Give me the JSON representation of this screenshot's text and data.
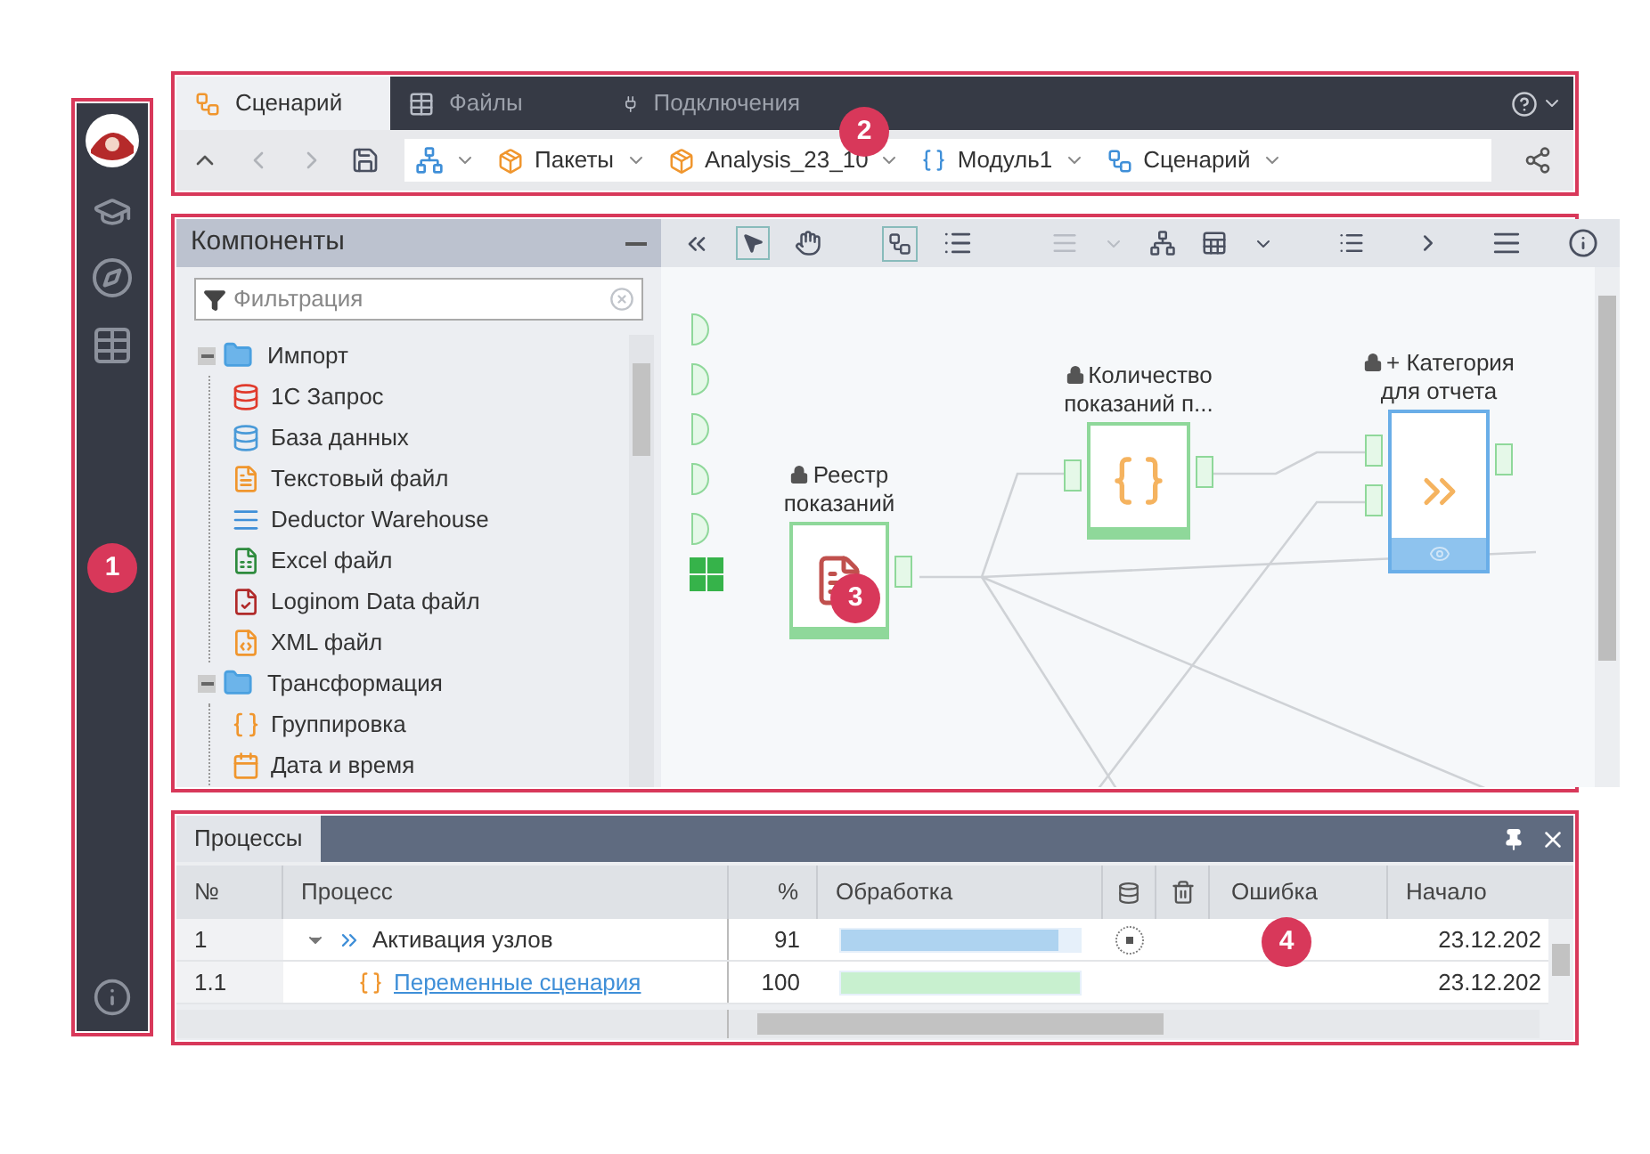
{
  "sidebar": {
    "callout": "1"
  },
  "top": {
    "callout": "2",
    "tabs": [
      {
        "label": "Сценарий",
        "selected": true,
        "kind": "scenario"
      },
      {
        "label": "Файлы",
        "selected": false,
        "kind": "files"
      },
      {
        "label": "Подключения",
        "selected": false,
        "kind": "connections"
      }
    ],
    "breadcrumbs": [
      {
        "label": "Пакеты",
        "kind": "package"
      },
      {
        "label": "Analysis_23_10",
        "kind": "package"
      },
      {
        "label": "Модуль1",
        "kind": "module"
      },
      {
        "label": "Сценарий",
        "kind": "scenario"
      }
    ]
  },
  "components": {
    "title": "Компоненты",
    "filter": {
      "placeholder": "Фильтрация"
    },
    "tree": [
      {
        "label": "Импорт",
        "expanded": true,
        "children": [
          {
            "label": "1С Запрос",
            "kind": "onec"
          },
          {
            "label": "База данных",
            "kind": "db"
          },
          {
            "label": "Текстовый файл",
            "kind": "text"
          },
          {
            "label": "Deductor Warehouse",
            "kind": "warehouse"
          },
          {
            "label": "Excel файл",
            "kind": "excel"
          },
          {
            "label": "Loginom Data файл",
            "kind": "lgd"
          },
          {
            "label": "XML файл",
            "kind": "xml"
          }
        ]
      },
      {
        "label": "Трансформация",
        "expanded": true,
        "children": [
          {
            "label": "Группировка",
            "kind": "group"
          },
          {
            "label": "Дата и время",
            "kind": "datetime"
          }
        ]
      }
    ]
  },
  "canvas": {
    "callout": "3",
    "nodes": [
      {
        "label": "Реестр показаний",
        "locked": true,
        "kind": "import"
      },
      {
        "label": "Количество показаний п...",
        "locked": true,
        "kind": "group"
      },
      {
        "label": "+ Категория для отчета",
        "locked": true,
        "kind": "calc"
      }
    ]
  },
  "processes": {
    "callout": "4",
    "tab": "Процессы",
    "columns": [
      "№",
      "Процесс",
      "%",
      "Обработка",
      "Ошибка",
      "Начало"
    ],
    "rows": [
      {
        "number": "1",
        "name": "Активация узлов",
        "percent": "91",
        "level": 0.91,
        "color": "#aed3f0",
        "start": "23.12.202",
        "kind": "group",
        "expanded": true,
        "stop_button": true
      },
      {
        "number": "1.1",
        "name": "Переменные сценария",
        "percent": "100",
        "level": 1,
        "color": "#c8f0cf",
        "start": "23.12.202",
        "kind": "link",
        "stop_button": false
      }
    ]
  }
}
